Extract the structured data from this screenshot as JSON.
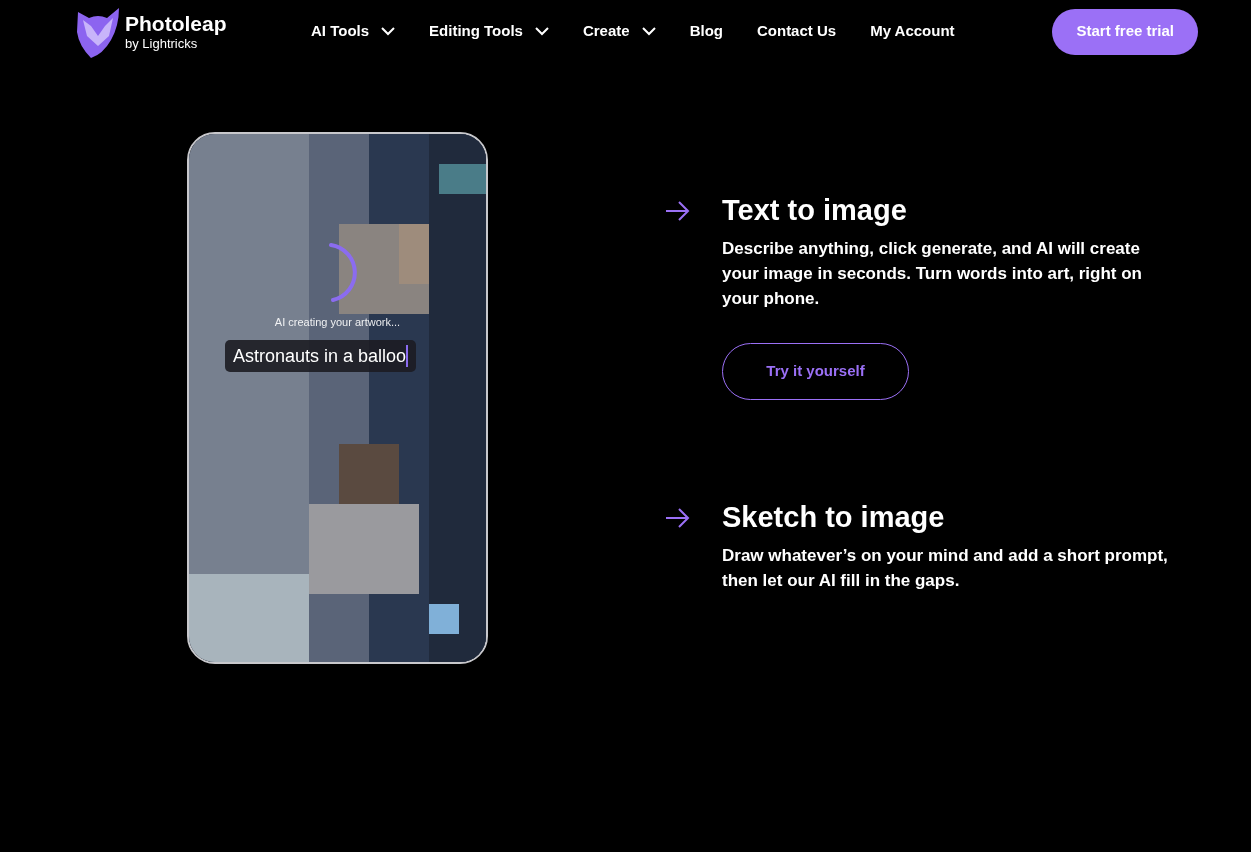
{
  "header": {
    "brand": {
      "name": "Photoleap",
      "byline": "by Lightricks"
    },
    "nav": [
      {
        "label": "AI Tools",
        "dropdown": true
      },
      {
        "label": "Editing Tools",
        "dropdown": true
      },
      {
        "label": "Create",
        "dropdown": true
      },
      {
        "label": "Blog",
        "dropdown": false
      },
      {
        "label": "Contact Us",
        "dropdown": false
      },
      {
        "label": "My Account",
        "dropdown": false
      }
    ],
    "cta": "Start free trial"
  },
  "phone": {
    "kind": "picture",
    "status": "AI creating your artwork...",
    "prompt": "Astronauts in a balloo"
  },
  "features": [
    {
      "title": "Text to image",
      "description": "Describe anything, click generate, and AI will create your image in seconds. Turn words into art, right on your phone.",
      "button": "Try it yourself"
    },
    {
      "title": "Sketch to image",
      "description": "Draw whatever’s on your mind and add a short prompt, then let our AI fill in the gaps."
    }
  ]
}
